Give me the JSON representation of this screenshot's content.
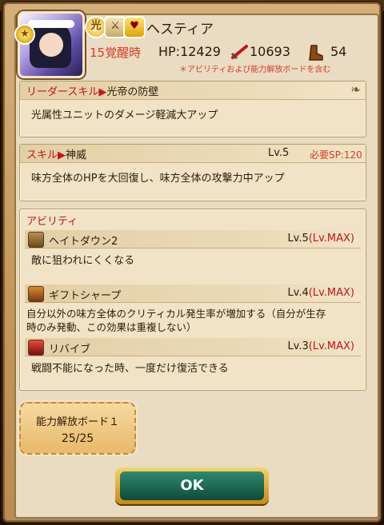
{
  "character": {
    "name": "ヘスティア",
    "awakening": "15覚醒時",
    "hp": "HP:12429",
    "attack": "10693",
    "speed": "54",
    "note": "＊アビリティおよび能力解放ボードを含む"
  },
  "leader_skill": {
    "label": "リーダースキル▶",
    "name": "光帝の防壁",
    "description": "光属性ユニットのダメージ軽減大アップ"
  },
  "skill": {
    "label": "スキル▶",
    "name": "神威",
    "level": "Lv.5",
    "sp": "必要SP:120",
    "description": "味方全体のHPを大回復し、味方全体の攻撃力中アップ"
  },
  "abilities": {
    "header": "アビリティ",
    "items": [
      {
        "name": "ヘイトダウン2",
        "level": "Lv.5",
        "max": "(Lv.MAX)",
        "description": "敵に狙われにくくなる"
      },
      {
        "name": "ギフトシャープ",
        "level": "Lv.4",
        "max": "(Lv.MAX)",
        "description_1": "自分以外の味方全体のクリティカル発生率が増加する（自分が生存",
        "description_2": "時のみ発動、この効果は重複しない）"
      },
      {
        "name": "リバイブ",
        "level": "Lv.3",
        "max": "(Lv.MAX)",
        "description": "戦闘不能になった時、一度だけ復活できる"
      }
    ]
  },
  "board": {
    "title": "能力解放ボード１",
    "count": "25/25"
  },
  "ok_button": "OK"
}
